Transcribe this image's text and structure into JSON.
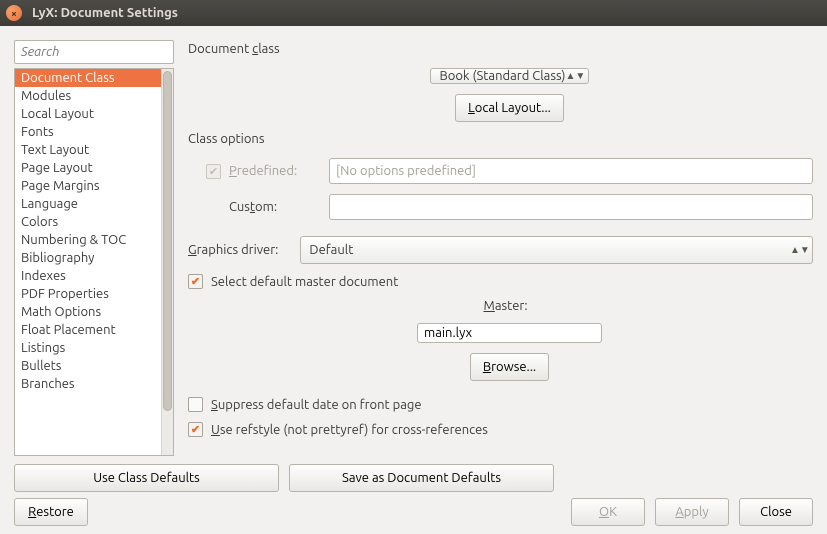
{
  "window": {
    "title": "LyX: Document Settings"
  },
  "search": {
    "placeholder": "Search"
  },
  "sidebar": {
    "items": [
      "Document Class",
      "Modules",
      "Local Layout",
      "Fonts",
      "Text Layout",
      "Page Layout",
      "Page Margins",
      "Language",
      "Colors",
      "Numbering & TOC",
      "Bibliography",
      "Indexes",
      "PDF Properties",
      "Math Options",
      "Float Placement",
      "Listings",
      "Bullets",
      "Branches"
    ],
    "selected": 0
  },
  "main": {
    "doc_class_head": "Document class",
    "doc_class_value": "Book (Standard Class)",
    "local_layout_btn": "Local Layout...",
    "class_options_head": "Class options",
    "predefined_label": "Predefined:",
    "predefined_value": "[No options predefined]",
    "custom_label": "Custom:",
    "custom_value": "",
    "graphics_label": "Graphics driver:",
    "graphics_value": "Default",
    "select_master_label": "Select default master document",
    "master_label": "Master:",
    "master_value": "main.lyx",
    "browse_btn": "Browse...",
    "suppress_label": "Suppress default date on front page",
    "refstyle_label": "Use refstyle (not prettyref) for cross-references"
  },
  "footer": {
    "use_class_defaults": "Use Class Defaults",
    "save_doc_defaults": "Save as Document Defaults",
    "restore": "Restore",
    "ok": "OK",
    "apply": "Apply",
    "close": "Close"
  }
}
